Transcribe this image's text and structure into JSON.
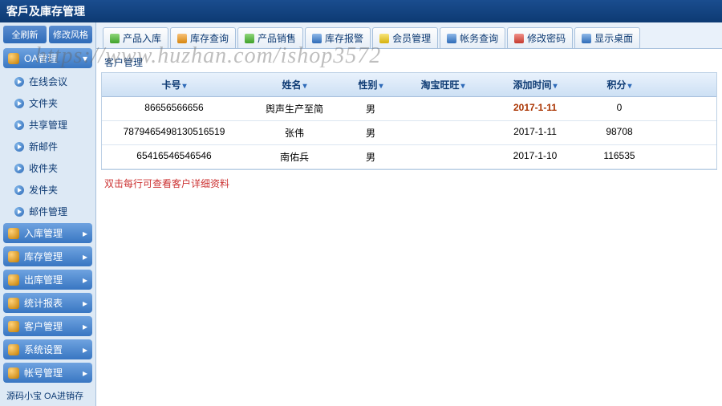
{
  "header": {
    "title": "客戶及庫存管理"
  },
  "watermark": "https://www.huzhan.com/ishop3572",
  "sidebar": {
    "mini": [
      "全刷新",
      "修改风格"
    ],
    "groups": [
      {
        "label": "OA管理",
        "expanded": true,
        "items": [
          "在线会议",
          "文件夹",
          "共享管理",
          "新邮件",
          "收件夹",
          "发件夹",
          "邮件管理"
        ]
      },
      {
        "label": "入库管理",
        "expanded": false
      },
      {
        "label": "库存管理",
        "expanded": false
      },
      {
        "label": "出库管理",
        "expanded": false
      },
      {
        "label": "统计报表",
        "expanded": false
      },
      {
        "label": "客户管理",
        "expanded": false
      },
      {
        "label": "系统设置",
        "expanded": false
      },
      {
        "label": "帐号管理",
        "expanded": false
      }
    ],
    "footer": "源码小宝 OA进销存"
  },
  "tabs": [
    {
      "icon": "green",
      "label": "产品入库"
    },
    {
      "icon": "orange",
      "label": "库存查询"
    },
    {
      "icon": "green",
      "label": "产品销售"
    },
    {
      "icon": "blue",
      "label": "库存报警"
    },
    {
      "icon": "yellow",
      "label": "会员管理"
    },
    {
      "icon": "blue",
      "label": "帐务查询"
    },
    {
      "icon": "red",
      "label": "修改密码"
    },
    {
      "icon": "blue",
      "label": "显示桌面"
    }
  ],
  "page": {
    "title": "客户管理"
  },
  "table": {
    "columns": [
      "卡号",
      "姓名",
      "性别",
      "淘宝旺旺",
      "添加时间",
      "积分",
      ""
    ],
    "rows": [
      {
        "card": "86656566656",
        "name": "舆声生产至简",
        "sex": "男",
        "ww": "",
        "date": "2017-1-11",
        "date_hot": true,
        "points": "0"
      },
      {
        "card": "787946549813051651​9",
        "name": "张伟",
        "sex": "男",
        "ww": "",
        "date": "2017-1-11",
        "date_hot": false,
        "points": "98708"
      },
      {
        "card": "65416546546546",
        "name": "南佑兵",
        "sex": "男",
        "ww": "",
        "date": "2017-1-10",
        "date_hot": false,
        "points": "116535"
      }
    ],
    "hint": "双击每行可查看客户详细资料"
  }
}
